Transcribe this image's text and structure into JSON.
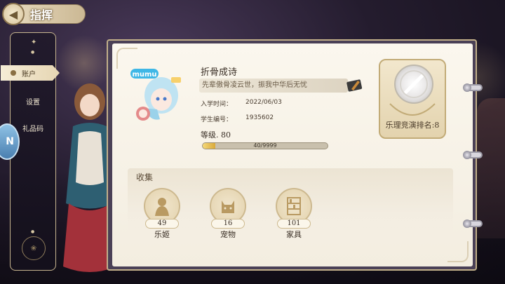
{
  "header": {
    "title": "指挥",
    "back_icon": "back-arrow-icon"
  },
  "nav": {
    "items": [
      {
        "label": "账户",
        "active": true
      },
      {
        "label": "设置",
        "active": false
      },
      {
        "label": "礼品码",
        "active": false
      }
    ]
  },
  "profile": {
    "avatar_badge": "mumu",
    "name": "折骨成诗",
    "signature": "先辈傲骨凌云世，振我中华后无忧",
    "enroll_label": "入学时间：",
    "enroll_value": "2022/06/03",
    "student_id_label": "学生编号：",
    "student_id_value": "1935602",
    "level_label": "等级. 80",
    "exp_text": "40/9999",
    "exp_fraction": 0.1
  },
  "rank": {
    "label": "乐理竞演排名:8"
  },
  "collection": {
    "title": "收集",
    "items": [
      {
        "name": "乐姬",
        "count": "49",
        "icon": "girl-silhouette-icon"
      },
      {
        "name": "宠物",
        "count": "16",
        "icon": "pet-icon"
      },
      {
        "name": "家具",
        "count": "101",
        "icon": "bookshelf-icon"
      }
    ]
  },
  "colors": {
    "accent_gold": "#c2ab77",
    "panel_bg": "#fbf7ee",
    "exp_fill": "#e7bf55"
  }
}
